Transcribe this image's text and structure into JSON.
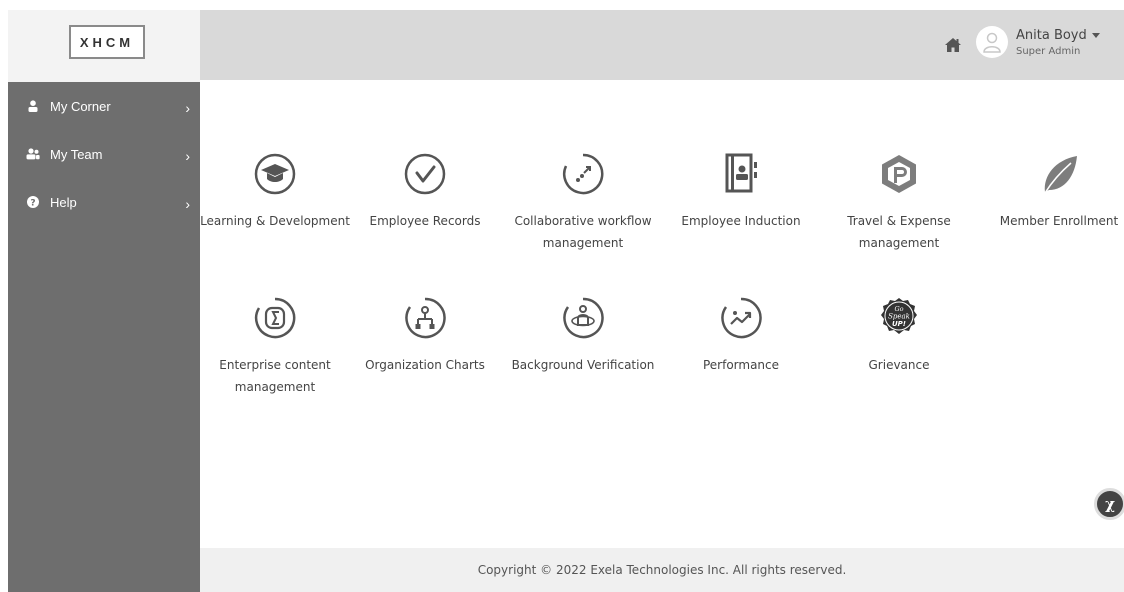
{
  "brand": {
    "logo_text": "XHCM"
  },
  "sidebar": {
    "items": [
      {
        "label": "My Corner",
        "icon": "user-icon"
      },
      {
        "label": "My Team",
        "icon": "users-icon"
      },
      {
        "label": "Help",
        "icon": "question-icon"
      }
    ]
  },
  "header": {
    "home_icon": "home-icon",
    "user": {
      "name": "Anita Boyd",
      "role": "Super Admin",
      "avatar_icon": "user-avatar-icon"
    }
  },
  "apps": [
    {
      "label": "Learning & Development",
      "icon": "graduation-cap-icon"
    },
    {
      "label": "Employee Records",
      "icon": "check-circle-icon"
    },
    {
      "label": "Collaborative workflow management",
      "icon": "workflow-icon"
    },
    {
      "label": "Employee Induction",
      "icon": "contact-book-icon"
    },
    {
      "label": "Travel & Expense management",
      "icon": "hexagon-p-icon"
    },
    {
      "label": "Member Enrollment",
      "icon": "leaf-icon"
    },
    {
      "label": "Enterprise content management",
      "icon": "content-icon"
    },
    {
      "label": "Organization Charts",
      "icon": "org-chart-icon"
    },
    {
      "label": "Background Verification",
      "icon": "verification-icon"
    },
    {
      "label": "Performance",
      "icon": "trend-up-icon"
    },
    {
      "label": "Grievance",
      "icon": "go-speak-up-icon"
    }
  ],
  "badges": {
    "grievance_text": [
      "Go",
      "Speak",
      "UP!"
    ]
  },
  "footer": {
    "copyright": "Copyright © 2022 Exela Technologies Inc. All rights reserved."
  },
  "colors": {
    "sidebar": "#6e6e6e",
    "header": "#d9d9d9",
    "icon": "#555555",
    "footer_bg": "#f0f0f0"
  }
}
